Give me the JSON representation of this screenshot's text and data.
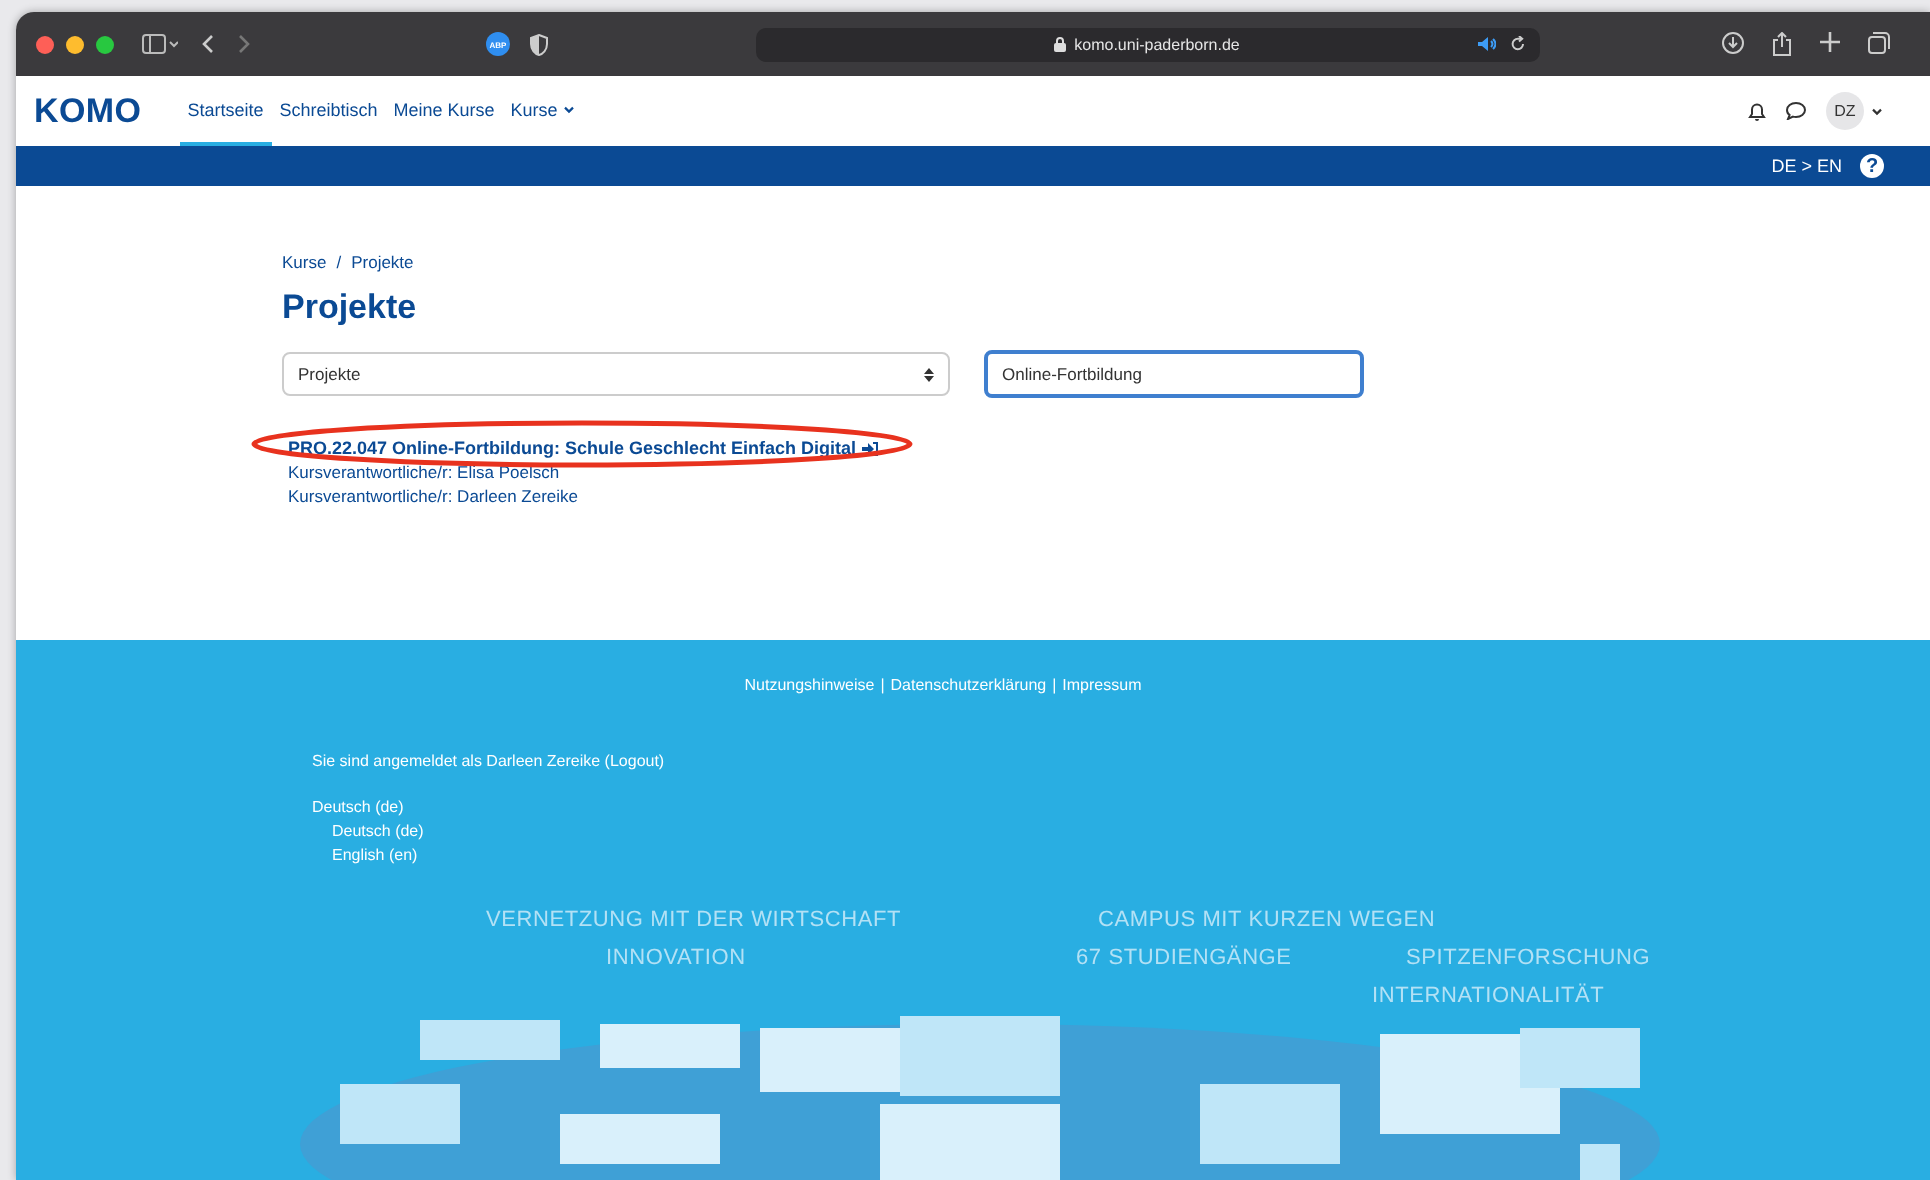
{
  "browser": {
    "url": "komo.uni-paderborn.de",
    "extension_badge": "ABP"
  },
  "navbar": {
    "logo": "KOMO",
    "items": [
      {
        "label": "Startseite",
        "selected": true,
        "kind": "link"
      },
      {
        "label": "Schreibtisch",
        "selected": false,
        "kind": "link"
      },
      {
        "label": "Meine Kurse",
        "selected": false,
        "kind": "link"
      },
      {
        "label": "Kurse",
        "selected": false,
        "kind": "dropdown"
      }
    ],
    "avatar": "DZ"
  },
  "language_bar": {
    "label": "DE > EN",
    "help": "?"
  },
  "breadcrumb": {
    "separator": "/",
    "items": [
      "Kurse",
      "Projekte"
    ]
  },
  "heading": "Projekte",
  "category_select": {
    "value": "Projekte"
  },
  "search": {
    "value": "Online-Fortbildung"
  },
  "results": [
    {
      "title": "PRO.22.047 Online-Fortbildung: Schule Geschlecht Einfach Digital",
      "circled": true,
      "managers": [
        "Kursverantwortliche/r: Elisa Poelsch",
        "Kursverantwortliche/r: Darleen Zereike"
      ]
    }
  ],
  "footer": {
    "links": [
      "Nutzungshinweise",
      "Datenschutzerklärung",
      "Impressum"
    ],
    "separator": "|",
    "login_note": "Sie sind angemeldet als Darleen Zereike (Logout)",
    "language_menu": {
      "label": "Deutsch (de)",
      "options": [
        "Deutsch (de)",
        "English (en)"
      ]
    },
    "slogans": [
      "VERNETZUNG MIT DER WIRTSCHAFT",
      "INNOVATION",
      "CAMPUS MIT KURZEN WEGEN",
      "67 STUDIENGÄNGE",
      "SPITZENFORSCHUNG",
      "INTERNATIONALITÄT"
    ]
  }
}
